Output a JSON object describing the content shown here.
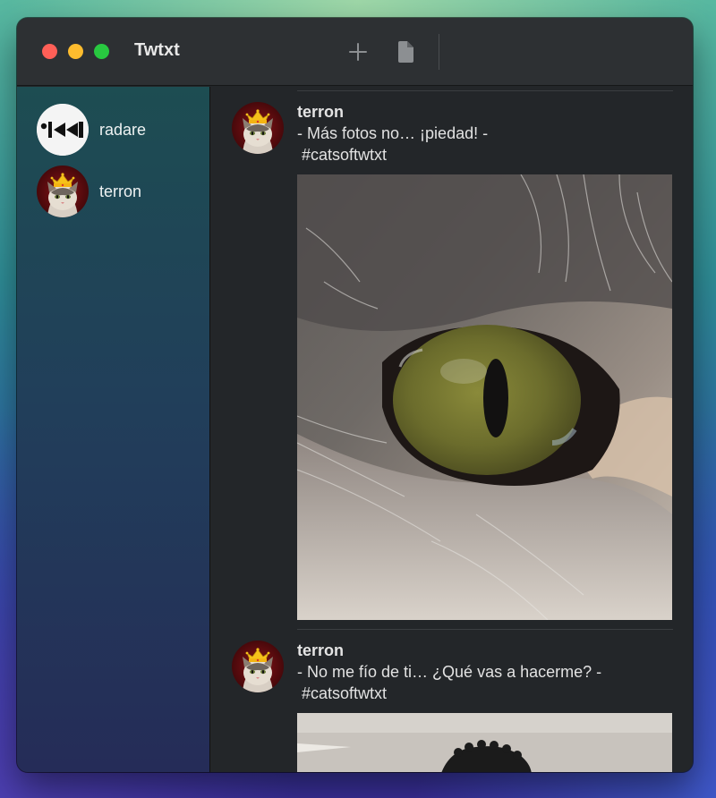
{
  "window": {
    "title": "Twtxt",
    "toolbar": {
      "add_icon": "plus-icon",
      "file_icon": "document-icon"
    }
  },
  "sidebar": {
    "users": [
      {
        "name": "radare",
        "avatar": "radare-logo"
      },
      {
        "name": "terron",
        "avatar": "cat-with-crown"
      }
    ]
  },
  "feed": {
    "posts": [
      {
        "author": "terron",
        "text_line1": "- Más fotos no… ¡piedad! -",
        "text_line2": "#catsoftwtxt",
        "image": "close-up of a cat's green eye"
      },
      {
        "author": "terron",
        "text_line1": "- No me fío de ti… ¿Qué vas a hacerme? -",
        "text_line2": "#catsoftwtxt",
        "image": "photo partially visible"
      }
    ]
  },
  "colors": {
    "title_text": "#e8e8e8",
    "titlebar_bg": "#2d3033",
    "content_bg": "#232629",
    "traffic_red": "#ff5f57",
    "traffic_yellow": "#febc2e",
    "traffic_green": "#28c840"
  }
}
